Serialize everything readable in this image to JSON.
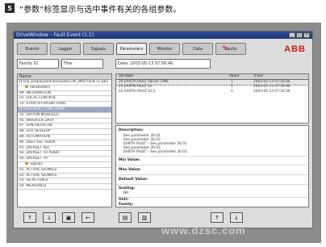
{
  "caption": {
    "number": "5",
    "text": "“参数”标签显示与选中事件有关的各组参数。"
  },
  "window": {
    "title": "DriveWindow – Fault Event (1.1)",
    "controls": [
      "_",
      "□",
      "×"
    ]
  },
  "tabs": [
    "Events",
    "Logger",
    "Signals",
    "Parameters",
    "Monitor",
    "Data",
    "Faults"
  ],
  "active_tab": "Parameters",
  "brand": {
    "logo": "ABB",
    "color": "#d7161b"
  },
  "fields": {
    "family": "Family ID",
    "fault": "Fiter",
    "date": "Date: 2003-05-13 07:56:46"
  },
  "tree": {
    "header": "Name",
    "items": [
      {
        "label": "D:\\Fw_Employee\\Flexi\\SDisk.FW_after fault s1.pen",
        "type": "root"
      },
      {
        "label": "Parameters",
        "type": "folder"
      },
      {
        "label": "99. INFORMATION",
        "type": "item"
      },
      {
        "label": "01. LOCAL CONTROL",
        "type": "item"
      },
      {
        "label": "10. START/STOP/DIR FUNC",
        "type": "item"
      },
      {
        "label": "OTHER FAULT FUNCTIONS",
        "type": "selected"
      },
      {
        "label": "35. OPTION MODULES",
        "type": "item"
      },
      {
        "label": "95. INVERTER DATA",
        "type": "item"
      },
      {
        "label": "97. SYNTHESIS 1N",
        "type": "item"
      },
      {
        "label": "88. DTA DEVELOP",
        "type": "item"
      },
      {
        "label": "89. AUTOMATION",
        "type": "item"
      },
      {
        "label": "90. DSET REC ADDR",
        "type": "item"
      },
      {
        "label": "91. DATASET REC",
        "type": "item"
      },
      {
        "label": "92. DATASET TR ADDR",
        "type": "item"
      },
      {
        "label": "93. DATASET TR",
        "type": "item"
      },
      {
        "label": "Signals",
        "type": "folder"
      },
      {
        "label": "01. ACTUAL SIGNALS",
        "type": "item"
      },
      {
        "label": "02. ACTUAL SIGNALS",
        "type": "item"
      },
      {
        "label": "03. FB ACTUALS",
        "type": "item"
      },
      {
        "label": "04. MEASURED",
        "type": "item"
      }
    ]
  },
  "event_list": {
    "headers": [
      "Variable",
      "Value",
      "Trace"
    ],
    "rows": [
      {
        "name": "20 EARTH FAULT DELAY TIME",
        "value": "1",
        "trace": "2003-05-13 07:56:46",
        "selected": true
      },
      {
        "name": "21 EARTH FAULT LV",
        "value": "1",
        "trace": "2003-05-13 07:56:46",
        "selected": false
      },
      {
        "name": "22 EARTH FAULT LV 2",
        "value": "0",
        "trace": "2003-05-13 07:56:46",
        "selected": false
      }
    ]
  },
  "details": {
    "description_label": "Description:",
    "description_lines": [
      "See parameter 30.01",
      "See parameter 30.03",
      "EARTH FAULT – See parameter 30.01",
      "See parameter 30.03",
      "EARTH FAULT – See parameter 30.03"
    ],
    "min_label": "Min Value:",
    "max_label": "Max Value:",
    "default_label": "Default Value:",
    "scaling_label": "Scaling:",
    "scaling_value": "NA",
    "unit_label": "Unit:",
    "family_label": "Family:"
  },
  "buttons": {
    "up": "↑",
    "down": "↓",
    "view": "▣",
    "back": "←",
    "save": "▤",
    "print": "▥",
    "page_up": "↑",
    "page_down": "↓"
  },
  "watermark": "www.dzsc.com"
}
